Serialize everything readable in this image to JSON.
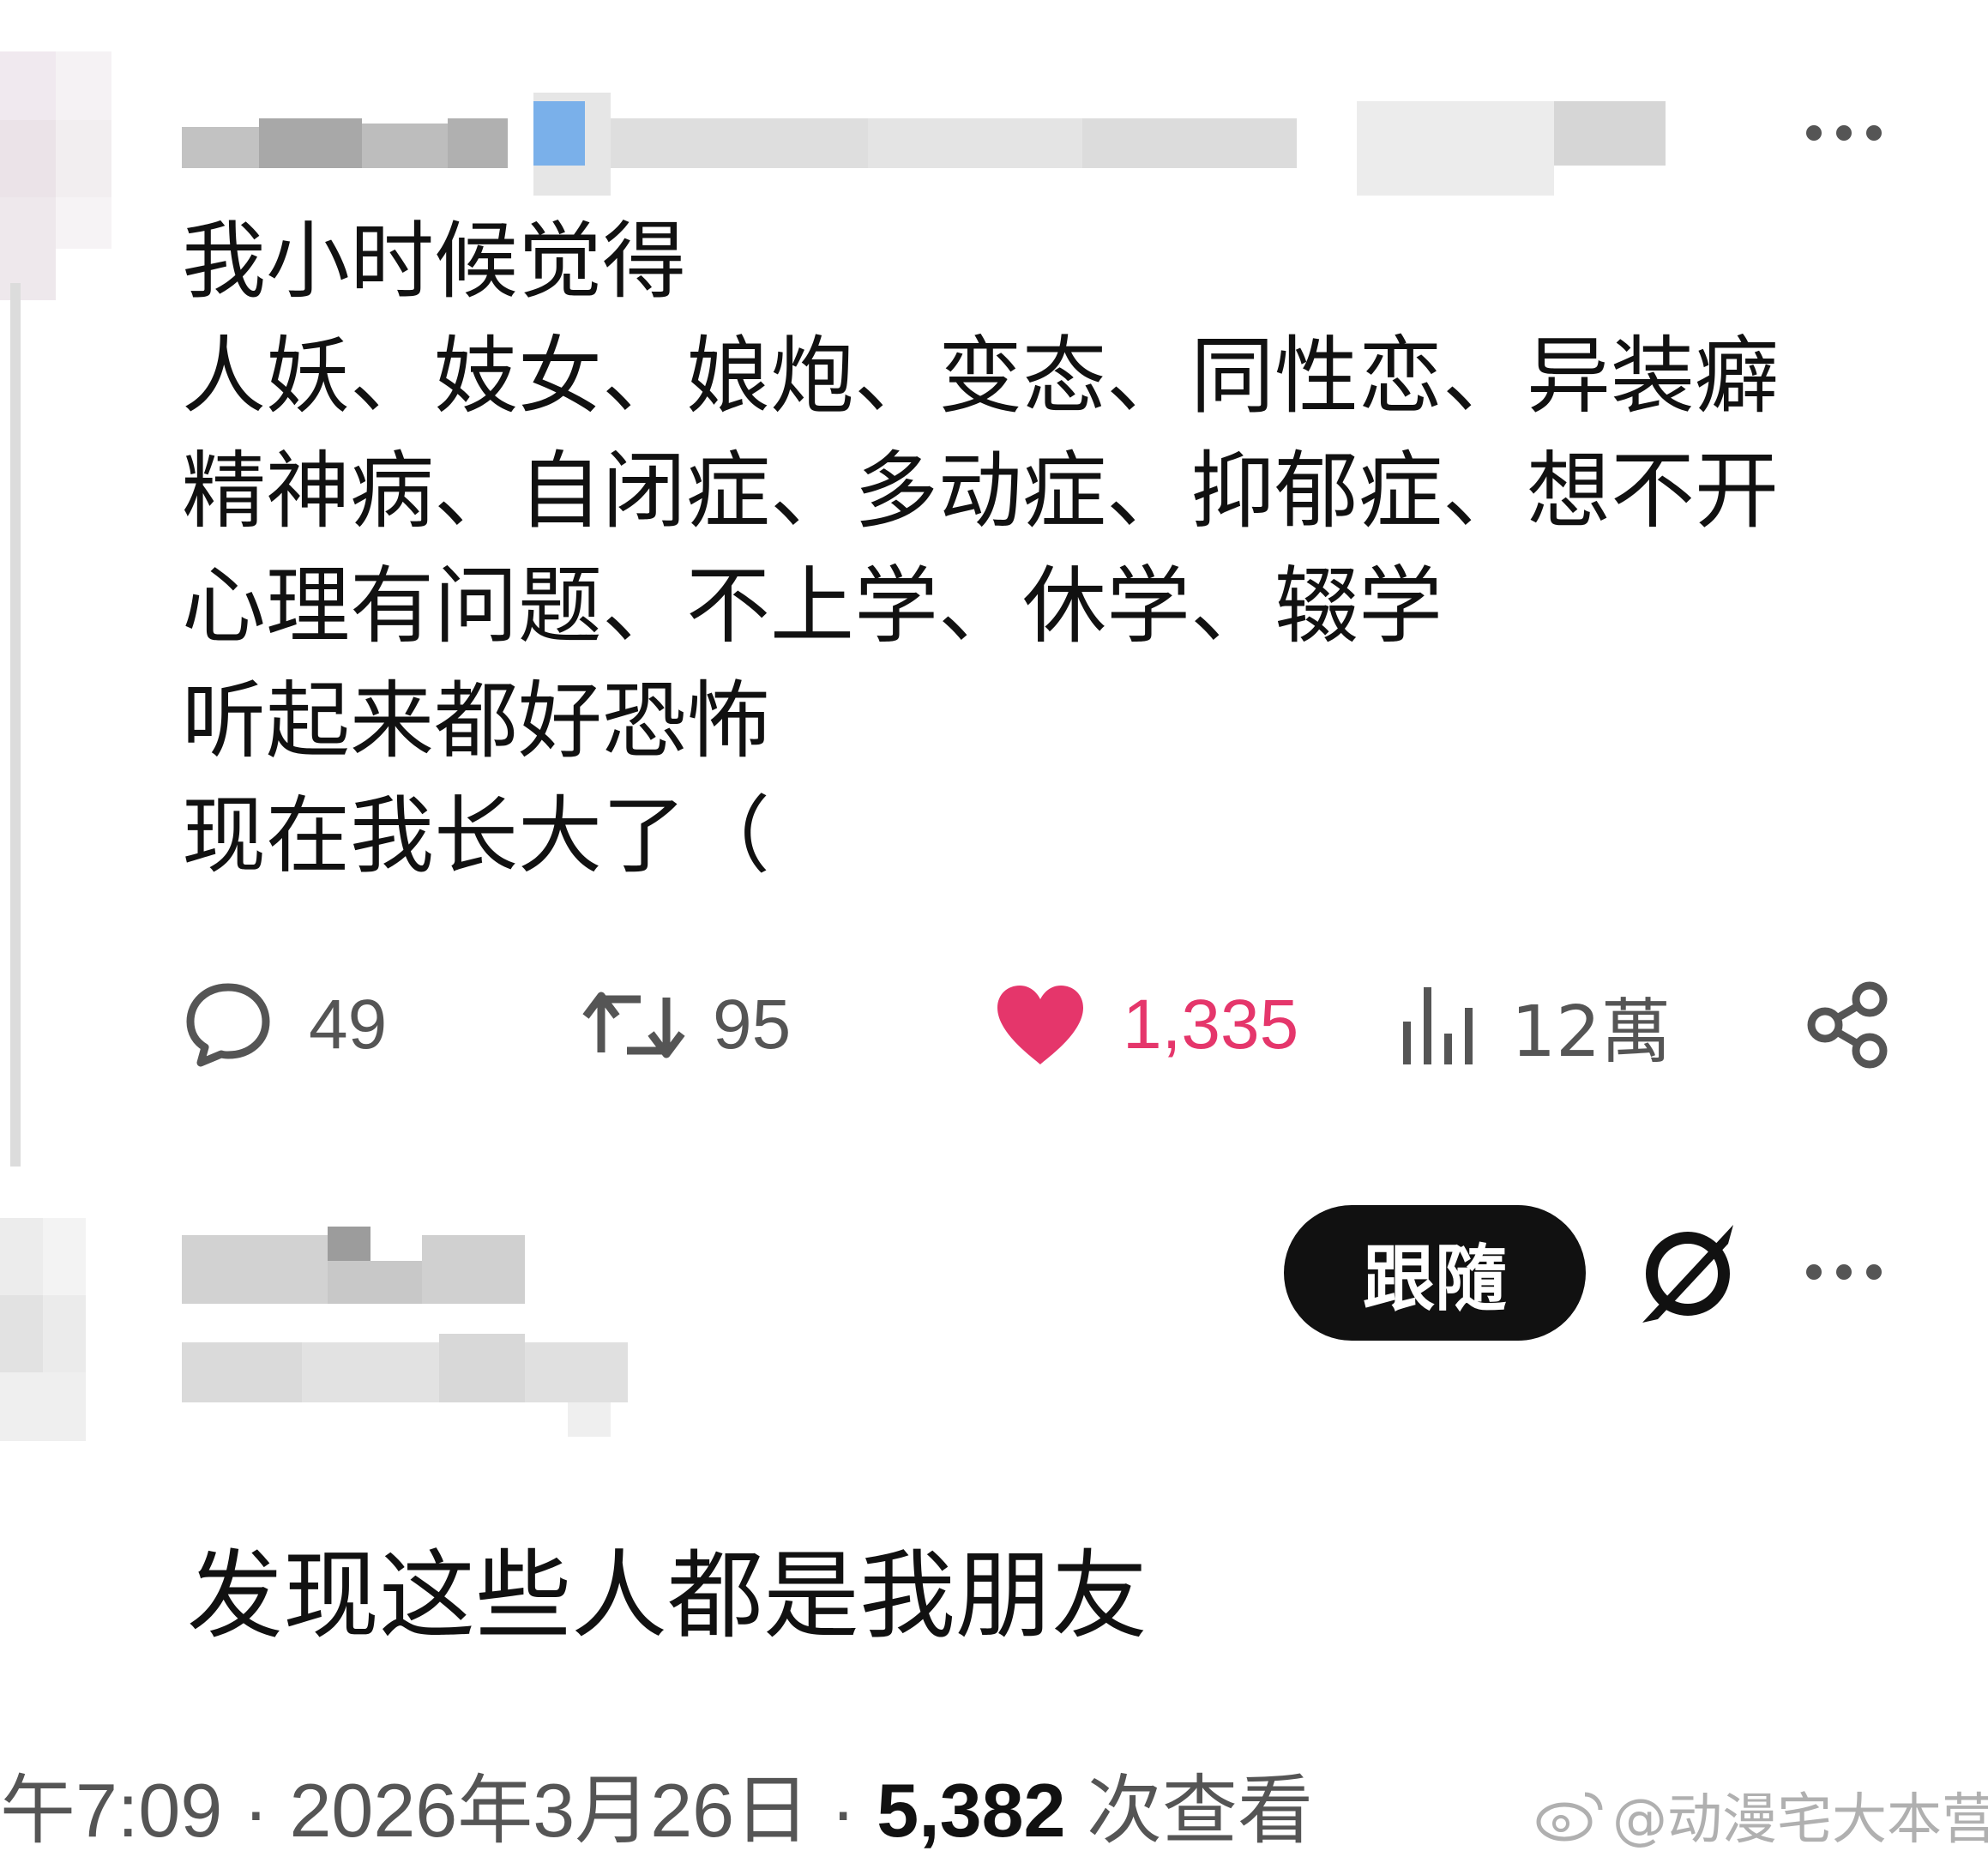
{
  "post": {
    "lines": [
      "我小时候觉得",
      "人妖、妓女、娘炮、变态、同性恋、异装癖",
      "精神病、自闭症、多动症、抑郁症、想不开",
      "心理有问题、不上学、休学、辍学",
      "听起来都好恐怖",
      "现在我长大了（"
    ],
    "more_icon": "ellipsis-icon",
    "actions": {
      "replies": "49",
      "reposts": "95",
      "likes": "1,335",
      "views": "12萬"
    },
    "colors": {
      "like": "#e5366b"
    }
  },
  "reply": {
    "follow_label": "跟隨",
    "text": "发现这些人都是我朋友"
  },
  "footer": {
    "time": "午7:09",
    "date": "2026年3月26日",
    "view_count": "5,382",
    "view_label": "次查看",
    "sep": " · "
  },
  "watermark": {
    "text": "@动漫宅大本营"
  }
}
